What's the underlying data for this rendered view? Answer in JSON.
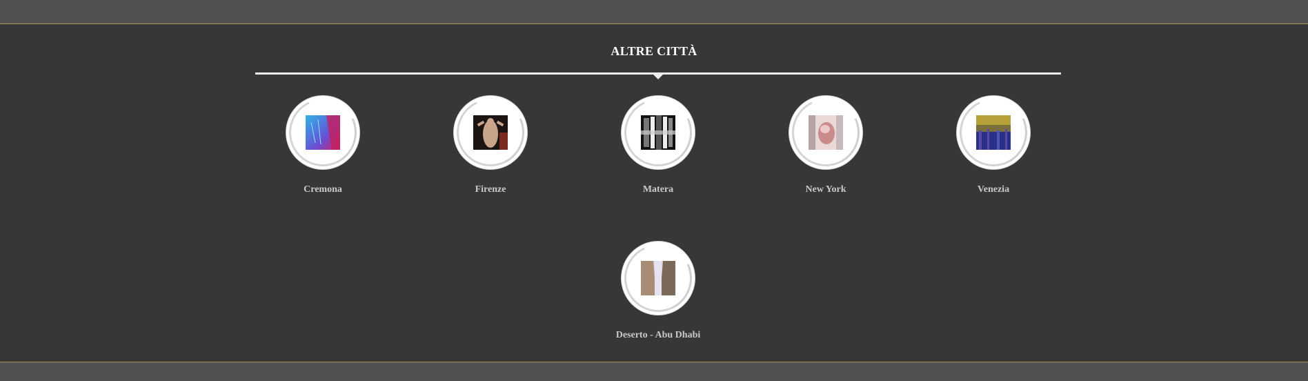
{
  "section": {
    "title": "ALTRE CITTÀ"
  },
  "cities": [
    {
      "name": "Cremona",
      "thumb_icon": "cremona-photo-icon",
      "thumb_colors": [
        "#2fb3e6",
        "#6a4fd6",
        "#d2206a"
      ]
    },
    {
      "name": "Firenze",
      "thumb_icon": "firenze-photo-icon",
      "thumb_colors": [
        "#1b1412",
        "#c8a48a",
        "#7a2a1e"
      ]
    },
    {
      "name": "Matera",
      "thumb_icon": "matera-photo-icon",
      "thumb_colors": [
        "#111111",
        "#eeeeee",
        "#777777"
      ]
    },
    {
      "name": "New York",
      "thumb_icon": "new-york-photo-icon",
      "thumb_colors": [
        "#e9d8d5",
        "#c98b8b",
        "#b6a5a8"
      ]
    },
    {
      "name": "Venezia",
      "thumb_icon": "venezia-photo-icon",
      "thumb_colors": [
        "#2a2f8a",
        "#b7a23a",
        "#5b4aa2"
      ]
    },
    {
      "name": "Deserto - Abu Dhabi",
      "thumb_icon": "abu-dhabi-photo-icon",
      "thumb_colors": [
        "#a88d74",
        "#d6d1e6",
        "#7b6a5a"
      ]
    }
  ],
  "colors": {
    "band": "#525050",
    "section_bg": "#373737",
    "accent_line": "#b0915a",
    "label": "#c9c9c9"
  }
}
